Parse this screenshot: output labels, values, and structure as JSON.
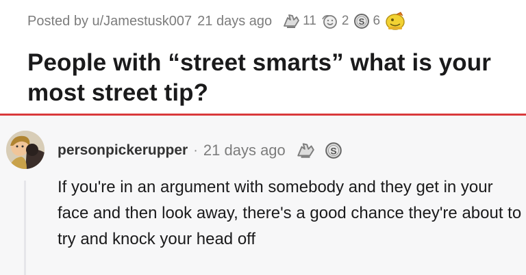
{
  "post": {
    "meta": {
      "posted_by": "Posted by u/Jamestusk007",
      "time": "21 days ago"
    },
    "awards": [
      {
        "icon": "hands-award-icon",
        "count": "11"
      },
      {
        "icon": "wholesome-award-icon",
        "count": "2"
      },
      {
        "icon": "silver-coin-icon",
        "count": "6"
      },
      {
        "icon": "gold-award-icon",
        "count": ""
      }
    ],
    "title": "People with “street smarts” what is your most street tip?"
  },
  "comment": {
    "username": "personpickerupper",
    "separator": "·",
    "time": "21 days ago",
    "awards": [
      {
        "icon": "hands-award-icon"
      },
      {
        "icon": "silver-coin-icon"
      }
    ],
    "body": "If you're in an argument with somebody and they get in your face and then look away, there's a good chance they're about to try and knock your head off"
  },
  "colors": {
    "divider": "#d9393b",
    "meta_text": "#7c7c7c",
    "comment_bg": "#f7f7f8",
    "title_text": "#1a1a1b"
  }
}
